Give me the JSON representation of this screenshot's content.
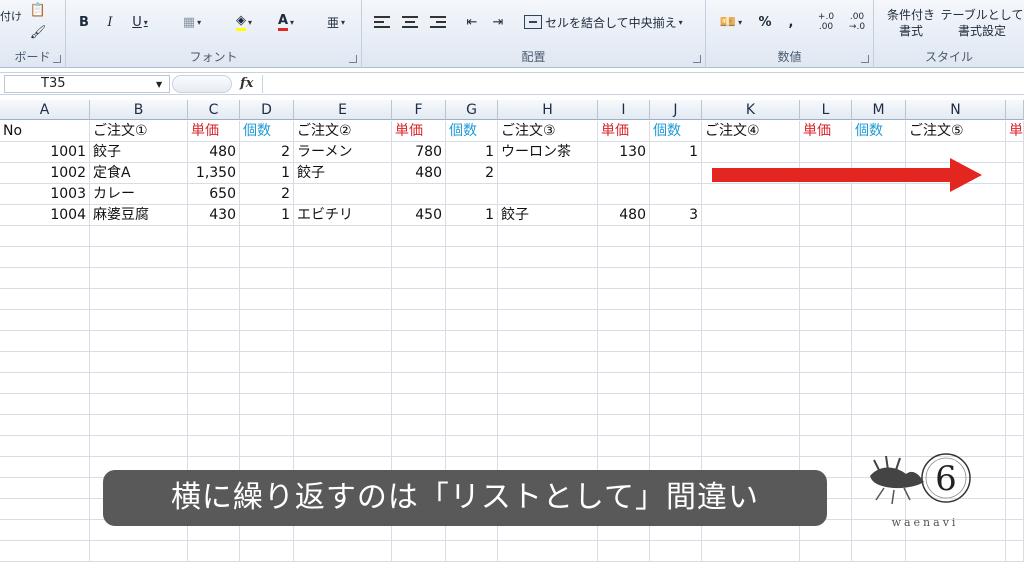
{
  "ribbon": {
    "clipboard_label": "ボード",
    "paste_partial": "付け",
    "font_label": "フォント",
    "bold": "B",
    "italic": "I",
    "underline": "U",
    "align_label": "配置",
    "merge_label": "セルを結合して中央揃え",
    "number_label": "数値",
    "percent": "%",
    "comma": ",",
    "dec_inc": "+.0\n.00",
    "dec_dec": ".00\n→.0",
    "style_label": "スタイル",
    "cond_format": "条件付き\n書式",
    "table_format": "テーブルとして\n書式設定"
  },
  "formula_bar": {
    "name_box": "T35",
    "fx": "fx"
  },
  "columns": [
    "A",
    "B",
    "C",
    "D",
    "E",
    "F",
    "G",
    "H",
    "I",
    "J",
    "K",
    "L",
    "M",
    "N"
  ],
  "rows": [
    [
      "No",
      "ご注文①",
      "単価",
      "個数",
      "ご注文②",
      "単価",
      "個数",
      "ご注文③",
      "単価",
      "個数",
      "ご注文④",
      "単価",
      "個数",
      "ご注文⑤",
      "単"
    ],
    [
      "1001",
      "餃子",
      "480",
      "2",
      "ラーメン",
      "780",
      "1",
      "ウーロン茶",
      "130",
      "1",
      "",
      "",
      "",
      "",
      ""
    ],
    [
      "1002",
      "定食A",
      "1,350",
      "1",
      "餃子",
      "480",
      "2",
      "",
      "",
      "",
      "",
      "",
      "",
      "",
      ""
    ],
    [
      "1003",
      "カレー",
      "650",
      "2",
      "",
      "",
      "",
      "",
      "",
      "",
      "",
      "",
      "",
      "",
      ""
    ],
    [
      "1004",
      "麻婆豆腐",
      "430",
      "1",
      "エビチリ",
      "450",
      "1",
      "餃子",
      "480",
      "3",
      "",
      "",
      "",
      "",
      ""
    ]
  ],
  "caption": "横に繰り返すのは「リストとして」間違い",
  "logo": {
    "text": "waenavi",
    "glyph": "6"
  },
  "colors": {
    "price": "#d8262b",
    "qty": "#1d9ad6",
    "arrow": "#e3261f",
    "caption_bg": "#525252"
  }
}
